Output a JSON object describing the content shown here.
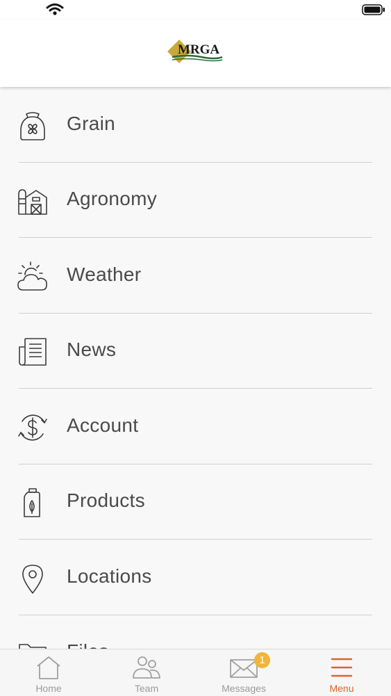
{
  "header": {
    "logo_text": "MRGA"
  },
  "menu": {
    "items": [
      {
        "label": "Grain",
        "icon": "grain-sack-icon"
      },
      {
        "label": "Agronomy",
        "icon": "barn-silo-icon"
      },
      {
        "label": "Weather",
        "icon": "sun-cloud-icon"
      },
      {
        "label": "News",
        "icon": "newspaper-icon"
      },
      {
        "label": "Account",
        "icon": "dollar-cycle-icon"
      },
      {
        "label": "Products",
        "icon": "jug-leaf-icon"
      },
      {
        "label": "Locations",
        "icon": "map-pin-icon"
      },
      {
        "label": "Files",
        "icon": "folder-icon"
      }
    ]
  },
  "tabbar": {
    "tabs": [
      {
        "label": "Home",
        "icon": "home-icon"
      },
      {
        "label": "Team",
        "icon": "team-icon"
      },
      {
        "label": "Messages",
        "icon": "envelope-icon",
        "badge": "1"
      },
      {
        "label": "Menu",
        "icon": "hamburger-menu-icon",
        "active": true
      }
    ]
  },
  "colors": {
    "accent": "#e0632a",
    "badge": "#f2b53a",
    "text": "#4a4a4a",
    "logo_gold": "#c9a93a",
    "logo_green": "#2e6b3a"
  }
}
